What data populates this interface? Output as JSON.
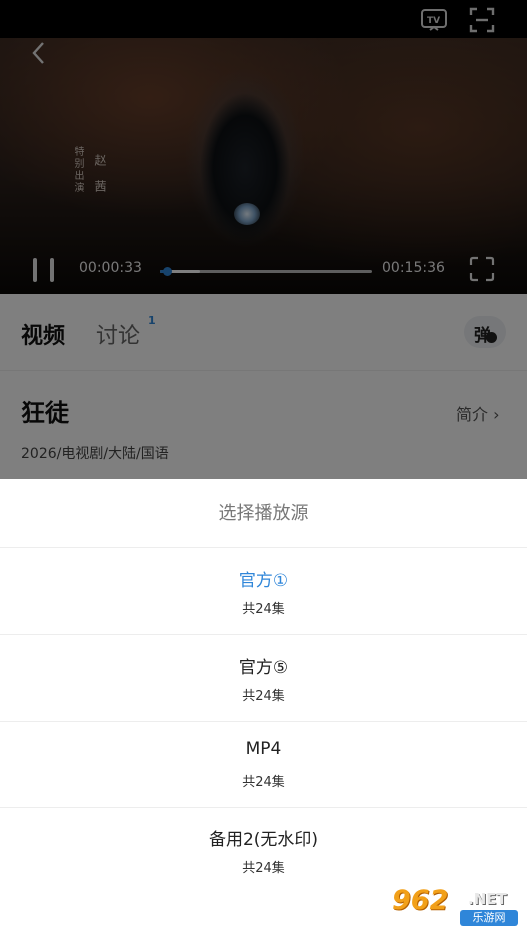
{
  "player": {
    "current_time": "00:00:33",
    "total_time": "00:15:36",
    "progress_fraction": 0.035,
    "buffer_fraction": 0.19,
    "credit_role": "特别出演",
    "credit_name": "赵茜"
  },
  "tabs": [
    {
      "label": "视频"
    },
    {
      "label": "讨论",
      "badge": "1"
    }
  ],
  "danmu_label": "弹",
  "show": {
    "title": "狂徒",
    "intro_link": "简介 ›",
    "meta": "2026/电视剧/大陆/国语"
  },
  "sheet": {
    "title": "选择播放源",
    "options": [
      {
        "name": "官方①",
        "count": "共24集",
        "selected": true
      },
      {
        "name": "官方⑤",
        "count": "共24集",
        "selected": false
      },
      {
        "name": "MP4",
        "count": "共24集",
        "selected": false
      },
      {
        "name": "备用2(无水印)",
        "count": "共24集",
        "selected": false
      }
    ]
  },
  "watermark": {
    "main": "962",
    "suffix": ".NET",
    "sub": "乐游网"
  },
  "colors": {
    "accent": "#2f86d9",
    "overlay": "rgba(0,0,0,0.5)"
  },
  "icons": [
    "tv-cast-icon",
    "screen-capture-icon",
    "back-arrow-icon",
    "pause-icon",
    "fullscreen-icon",
    "danmu-toggle-icon"
  ]
}
